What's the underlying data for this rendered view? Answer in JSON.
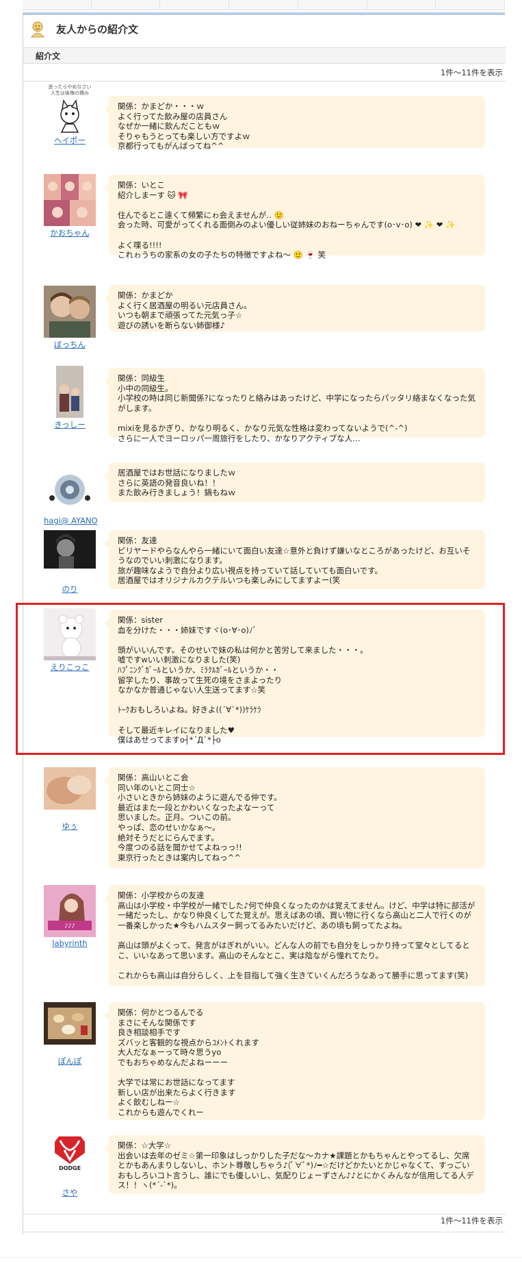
{
  "header": {
    "title": "友人からの紹介文"
  },
  "section": {
    "label": "紹介文"
  },
  "pager": {
    "top": "1件～11件を表示",
    "bottom": "1件～11件を表示"
  },
  "entries": [
    {
      "name": "ヘイポー",
      "text": "関係：かまどか・・・ｗ\nよく行ってた飲み屋の店員さん\nなぜか一緒に飲んだこともｗ\nそりゃもうとっても楽しい方ですよｗ\n京都行ってもがんばってね^^"
    },
    {
      "name": "かおちゃん",
      "text": "関係：いとこ\n紹介しまーす 🐱 🎀\n\n住んでるとこ遠くて頻繁にゎ会えませんが‥ 🙂\n会った時、可愛がってくれる面倒みのよい優しい従姉妹のおねーちゃんです(o･v･o) ❤ ✨ ❤ ✨\n\nよく喋る!!!!\nこれゎうちの家系の女の子たちの特徴ですよね～ 🙂 🍷 笑"
    },
    {
      "name": "ぼっちん",
      "text": "関係：かまどか\nよく行く居酒屋の明るい元店員さん。\nいつも朝まで頑張ってた元気っ子☆\n遊びの誘いを断らない姉御様♪"
    },
    {
      "name": "きっしー",
      "text": "関係：同級生\n小中の同級生。\n小学校の時は同じ新聞係?になったりと絡みはあったけど、中学になったらパッタリ絡まなくなった気がします。\n\nmixiを見るかぎり、かなり明るく、かなり元気な性格は変わってないようで(^-^)\nさらに一人でヨーロッパ一周旅行をしたり、かなりアクティブな人…"
    },
    {
      "name": "hagi@ AYANO",
      "text": "居酒屋ではお世話になりましたｗ\nさらに英語の発音良いね！！\nまた飲み行きましょう！鍋もねｗ"
    },
    {
      "name": "のり",
      "text": "関係：友達\nビリヤードやらなんやら一緒にいて面白い友達☆意外と負けず嫌いなところがあったけど、お互いそうなのでいい刺激になります。\n旅が趣味なようで自分より広い視点を持っていて話していても面白いです。\n居酒屋ではオリジナルカクテルいつも楽しみにしてますよー(笑"
    },
    {
      "name": "えりこっこ",
      "text": "関係：sister\n血を分けた・・・姉妹ですヾ(o･∀･o)ﾉﾞ\n\n頭がいいんです。そのせいで妹の私は何かと苦労して来ました・・・。\n嘘ですwいい刺激になりました(笑)\nﾊﾌﾟﾆﾝｸﾞｶﾞｰﾙというか、ﾐﾗｸﾙｶﾞｰﾙというか・・\n留学したり、事故って生死の境をさまよったり\nなかなか普通じゃない人生送ってます☆笑\n\nﾄｰｸおもしろいよね。好きよ((´∀`*))ｹﾗｹﾗ\n\nそして最近キレイになりました♥\n僕はあせってますo┤*´Д`*├o"
    },
    {
      "name": "ゆぅ",
      "text": "関係：高山いとこ会\n同い年のいとこ同士☆\n小さいときから姉妹のように遊んでる仲です。\n最近はまた一段とかわいくなったよなーって\n思いました。正月。ついこの前。\nやっぱ、恋のせいかなぁ～。\n絶対そうだとにらんでます。\n今度つのる話を聞かせてよねっっ!!\n東京行ったときは案内してねっ^^"
    },
    {
      "name": "labyrinth",
      "text": "関係：小学校からの友達\n高山は小学校・中学校が一緒でした♪何で仲良くなったのかは覚えてません。けど、中学は特に部活が一緒だったし、かなり仲良くしてた覚えが。思えばあの頃、買い物に行くなら高山と二人で行くのが一番楽しかった★今もハムスター飼ってるみたいだけど、あの頃も飼ってたよね。\n\n高山は頭がよくって、発言がはぎれがいい。どんな人の前でも自分をしっかり持って堂々としてるとこ、いいなあって思います。高山のそんなとこ、実は陰ながら憧れてたり。\n\nこれからも高山は自分らしく、上を目指して強く生きていくんだろうなあって勝手に思ってます(笑)"
    },
    {
      "name": "ぽんぽ",
      "text": "関係：何かとつるんでる\nまさにそんな関係です\n良き相談相手です\nズバッと客観的な視点からｺﾒﾝﾄくれます\n大人だなぁーって時々思うyo\nでもおちゃめなんだよねーーー\n\n大学では常にお世話になってます\n新しい店が出来たらよく行きます\nよく飲むしねー☆\nこれからも遊んでくれー"
    },
    {
      "name": "さや",
      "logo": "DODGE",
      "text": "関係：☆大学☆\n出会いは去年のゼミ☆第一印象はしっかりした子だな～カナ★課題とかもちゃんとやってるし、欠席とかもあんまりしないし、ホント尊敬しちゃう♪(ﾟ∀ﾟ*)ﾉ━☆だけどかたいとかじゃなくて、すっごいおもしろいコト言うし、誰にでも優しいし、気配りじょーずさん♪♪とにかくみんなが信用してる人デス！！ヽ(*´-`*)。"
    }
  ]
}
